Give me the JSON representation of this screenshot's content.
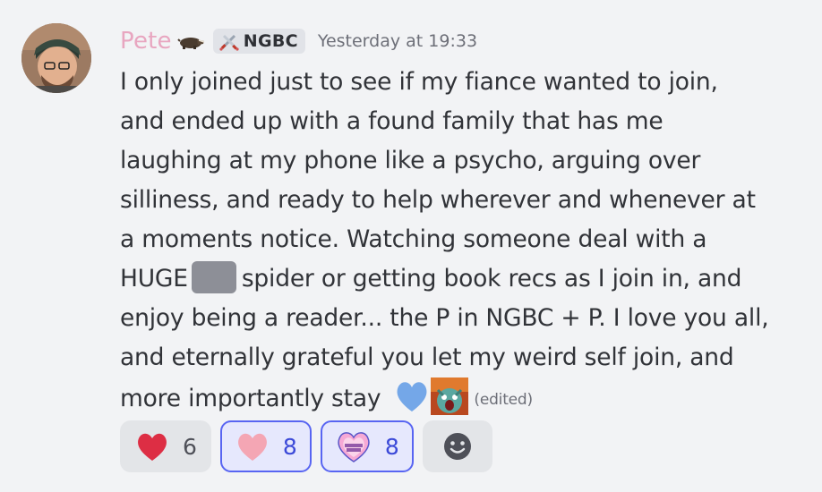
{
  "message": {
    "author": "Pete",
    "author_decoration": "badger-icon",
    "tag": {
      "label": "NGBC",
      "icon": "crossed-swords-icon"
    },
    "timestamp": "Yesterday at 19:33",
    "lines": [
      "I only joined just to see if my fiance wanted to join,",
      "and ended up with a found family that has me",
      "laughing at my phone like a psycho, arguing over",
      "silliness, and ready to help wherever and whenever at",
      "a moments notice. Watching someone deal with a"
    ],
    "spoiler_line": {
      "before": "HUGE",
      "after": "spider or getting book recs as I join in, and"
    },
    "lines_after": [
      "enjoy being a reader... the P in NGBC + P. I love you all,",
      "and eternally grateful you let my weird self join, and"
    ],
    "last_line": "more importantly stay",
    "inline_emojis": [
      "blue-heart-icon",
      "screaming-gremlin-emoji"
    ],
    "edited_label": "(edited)"
  },
  "reactions": [
    {
      "emoji": "red-heart-icon",
      "count": "6",
      "active": false
    },
    {
      "emoji": "pink-heart-icon",
      "count": "8",
      "active": true
    },
    {
      "emoji": "love-you-heart-icon",
      "count": "8",
      "active": true
    }
  ],
  "add_reaction_icon": "smiley-add-reaction-icon",
  "colors": {
    "username": "#e8a6c0",
    "active_reaction_border": "#5865f2",
    "active_reaction_bg": "#e6e8fd",
    "background": "#f2f3f5"
  }
}
